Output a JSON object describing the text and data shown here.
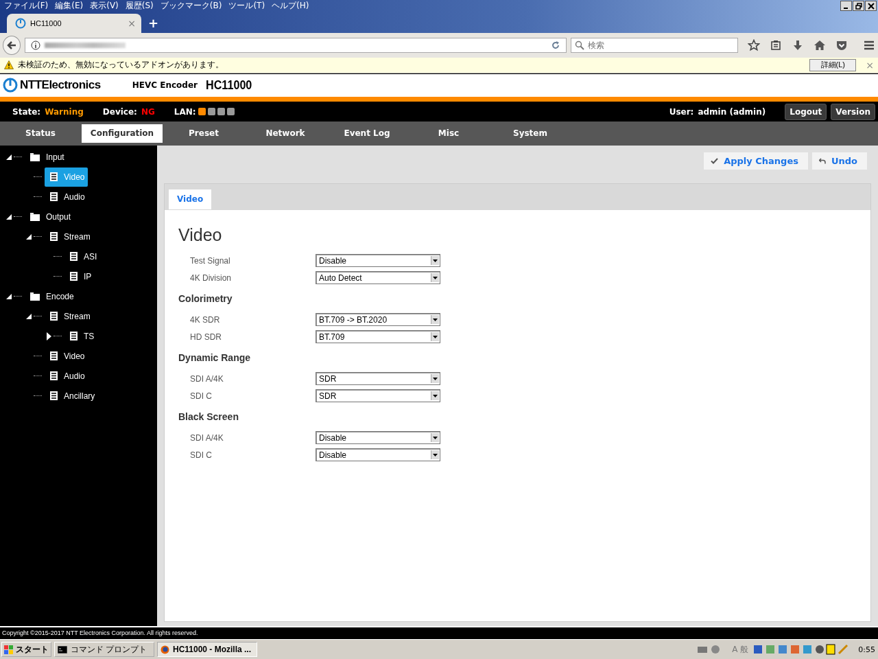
{
  "browser": {
    "menu": [
      "ファイル(F)",
      "編集(E)",
      "表示(V)",
      "履歴(S)",
      "ブックマーク(B)",
      "ツール(T)",
      "ヘルプ(H)"
    ],
    "tab_title": "HC11000",
    "tab_close": "×",
    "new_tab": "+",
    "search_placeholder": "検索",
    "notification": {
      "text": "未検証のため、無効になっているアドオンがあります。",
      "button": "詳細(L)",
      "close": "×"
    }
  },
  "header": {
    "brand": "NTTElectronics",
    "product": "HEVC Encoder",
    "model": "HC11000"
  },
  "status": {
    "state_label": "State:",
    "state": "Warning",
    "device_label": "Device:",
    "device": "NG",
    "lan_label": "LAN:",
    "lan_ports": [
      {
        "on": true
      },
      {
        "on": false
      },
      {
        "on": false
      },
      {
        "on": false
      }
    ],
    "user_label": "User:",
    "user": "admin (admin)",
    "buttons": [
      "Logout",
      "Version"
    ]
  },
  "nav": [
    {
      "label": "Status",
      "selected": false
    },
    {
      "label": "Configuration",
      "selected": true
    },
    {
      "label": "Preset",
      "selected": false
    },
    {
      "label": "Network",
      "selected": false
    },
    {
      "label": "Event Log",
      "selected": false
    },
    {
      "label": "Misc",
      "selected": false
    },
    {
      "label": "System",
      "selected": false
    }
  ],
  "tree": [
    {
      "label": "Input",
      "kind": "folder",
      "expanded": true,
      "selected": false,
      "children": [
        {
          "label": "Video",
          "kind": "page",
          "selected": true
        },
        {
          "label": "Audio",
          "kind": "page",
          "selected": false
        }
      ]
    },
    {
      "label": "Output",
      "kind": "folder",
      "expanded": true,
      "selected": false,
      "children": [
        {
          "label": "Stream",
          "kind": "page",
          "expanded": true,
          "selected": false,
          "children": [
            {
              "label": "ASI",
              "kind": "page",
              "selected": false
            },
            {
              "label": "IP",
              "kind": "page",
              "selected": false
            }
          ]
        }
      ]
    },
    {
      "label": "Encode",
      "kind": "folder",
      "expanded": true,
      "selected": false,
      "children": [
        {
          "label": "Stream",
          "kind": "page",
          "expanded": true,
          "selected": false,
          "children": [
            {
              "label": "TS",
              "kind": "page",
              "expanded": false,
              "selected": false
            }
          ]
        },
        {
          "label": "Video",
          "kind": "page",
          "selected": false
        },
        {
          "label": "Audio",
          "kind": "page",
          "selected": false
        },
        {
          "label": "Ancillary",
          "kind": "page",
          "selected": false
        }
      ]
    }
  ],
  "actions": [
    "Apply Changes",
    "Undo"
  ],
  "panel": {
    "tab": "Video",
    "title": "Video",
    "sections": [
      {
        "fields": [
          {
            "label": "Test Signal",
            "value": "Disable"
          },
          {
            "label": "4K Division",
            "value": "Auto Detect"
          }
        ]
      },
      {
        "title": "Colorimetry",
        "fields": [
          {
            "label": "4K SDR",
            "value": "BT.709 -> BT.2020"
          },
          {
            "label": "HD SDR",
            "value": "BT.709"
          }
        ]
      },
      {
        "title": "Dynamic Range",
        "fields": [
          {
            "label": "SDI A/4K",
            "value": "SDR"
          },
          {
            "label": "SDI C",
            "value": "SDR"
          }
        ]
      },
      {
        "title": "Black Screen",
        "fields": [
          {
            "label": "SDI A/4K",
            "value": "Disable"
          },
          {
            "label": "SDI C",
            "value": "Disable"
          }
        ]
      }
    ]
  },
  "footer": "Copyright ©2015-2017 NTT Electronics Corporation. All rights reserved.",
  "taskbar": {
    "start": "スタート",
    "tasks": [
      {
        "label": "コマンド プロンプト",
        "selected": false
      },
      {
        "label": "HC11000 - Mozilla ...",
        "selected": true
      }
    ],
    "ime": "A 般",
    "clock": "0:55"
  }
}
